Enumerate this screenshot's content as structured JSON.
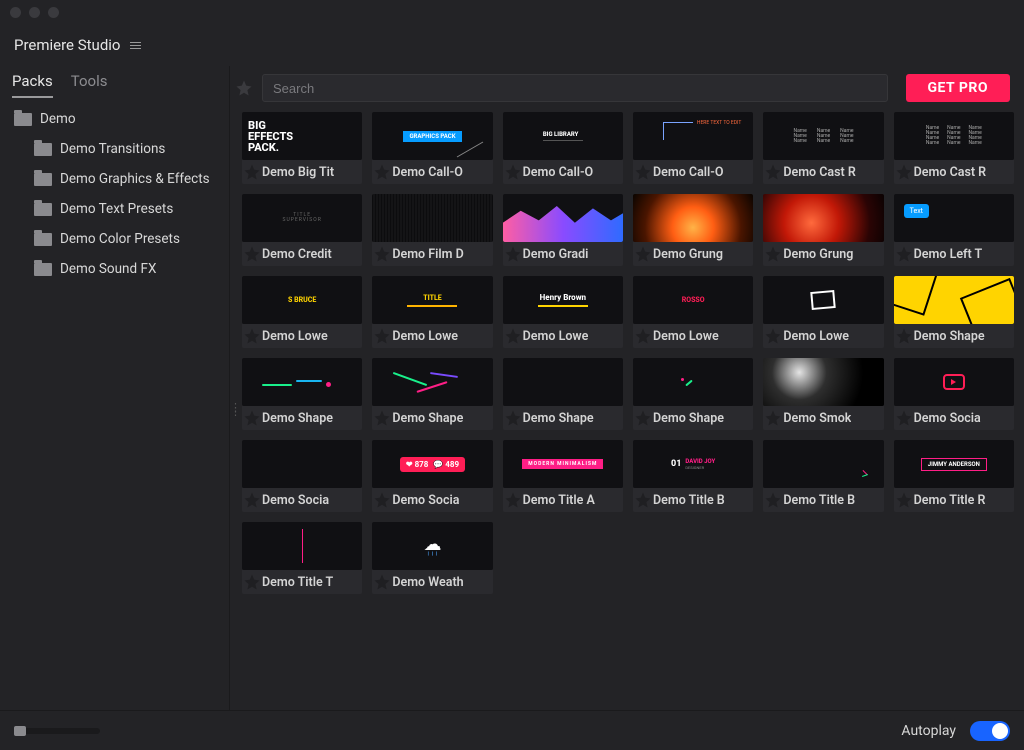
{
  "app": {
    "title": "Premiere Studio"
  },
  "tabs": {
    "packs": "Packs",
    "tools": "Tools"
  },
  "sidebar": {
    "root": "Demo",
    "items": [
      {
        "label": "Demo Transitions"
      },
      {
        "label": "Demo Graphics & Effects"
      },
      {
        "label": "Demo Text Presets"
      },
      {
        "label": "Demo Color Presets"
      },
      {
        "label": "Demo Sound FX"
      }
    ]
  },
  "search": {
    "placeholder": "Search"
  },
  "cta": {
    "getpro": "GET PRO"
  },
  "footer": {
    "autoplay_label": "Autoplay",
    "autoplay_on": true
  },
  "thumb_text": {
    "big_effects": "BIG\nEFFECTS\nPACK.",
    "graphics_pack": "GRAPHICS PACK",
    "big_library": "BIG LIBRARY",
    "here_text": "HERE TEXT TO EDIT",
    "chat": "Text",
    "bruce": "S BRUCE",
    "henry": "Henry Brown",
    "rosso": "ROSSO",
    "social_like": "878",
    "social_comment": "489",
    "modern": "MODERN MINIMALISM",
    "david": "01 DAVID JOY",
    "david_sub": "DESIGNER",
    "jimmy": "JIMMY ANDERSON",
    "credits": "TITLE\nSUPERVISOR"
  },
  "grid": [
    {
      "label": "Demo Big Tit"
    },
    {
      "label": "Demo Call-O"
    },
    {
      "label": "Demo Call-O"
    },
    {
      "label": "Demo Call-O"
    },
    {
      "label": "Demo Cast R"
    },
    {
      "label": "Demo Cast R"
    },
    {
      "label": "Demo Credit"
    },
    {
      "label": "Demo Film D"
    },
    {
      "label": "Demo Gradi"
    },
    {
      "label": "Demo Grung"
    },
    {
      "label": "Demo Grung"
    },
    {
      "label": "Demo Left T"
    },
    {
      "label": "Demo Lowe"
    },
    {
      "label": "Demo Lowe"
    },
    {
      "label": "Demo Lowe"
    },
    {
      "label": "Demo Lowe"
    },
    {
      "label": "Demo Lowe"
    },
    {
      "label": "Demo Shape"
    },
    {
      "label": "Demo Shape"
    },
    {
      "label": "Demo Shape"
    },
    {
      "label": "Demo Shape"
    },
    {
      "label": "Demo Shape"
    },
    {
      "label": "Demo Smok"
    },
    {
      "label": "Demo Socia"
    },
    {
      "label": "Demo Socia"
    },
    {
      "label": "Demo Socia"
    },
    {
      "label": "Demo Title A"
    },
    {
      "label": "Demo Title B"
    },
    {
      "label": "Demo Title B"
    },
    {
      "label": "Demo Title R"
    },
    {
      "label": "Demo Title T"
    },
    {
      "label": "Demo Weath"
    }
  ]
}
